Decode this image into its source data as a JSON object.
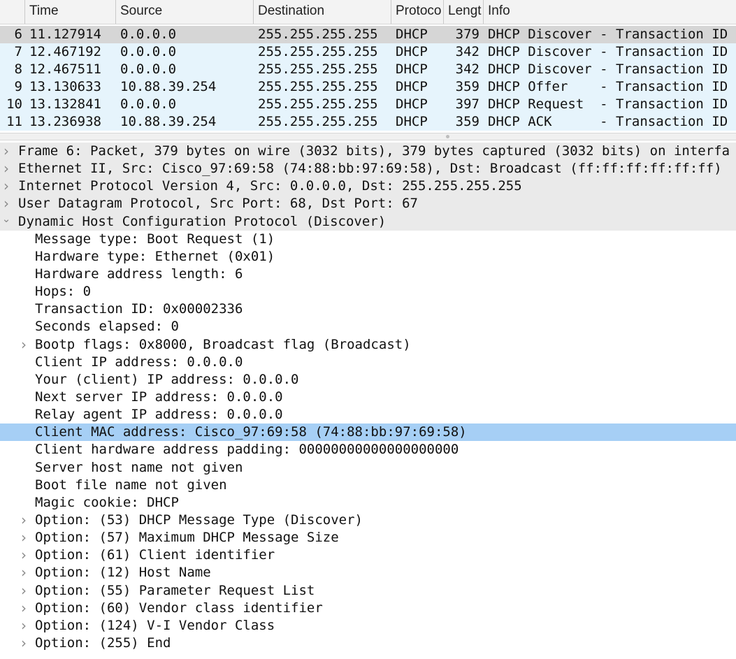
{
  "columns": [
    "Time",
    "Source",
    "Destination",
    "Protoco",
    "Lengt",
    "Info"
  ],
  "packets": [
    {
      "no": "6",
      "time": "11.127914",
      "source": "0.0.0.0",
      "destination": "255.255.255.255",
      "protocol": "DHCP",
      "length": "379",
      "info": "DHCP Discover - Transaction ID",
      "selected": true
    },
    {
      "no": "7",
      "time": "12.467192",
      "source": "0.0.0.0",
      "destination": "255.255.255.255",
      "protocol": "DHCP",
      "length": "342",
      "info": "DHCP Discover - Transaction ID",
      "selected": false
    },
    {
      "no": "8",
      "time": "12.467511",
      "source": "0.0.0.0",
      "destination": "255.255.255.255",
      "protocol": "DHCP",
      "length": "342",
      "info": "DHCP Discover - Transaction ID",
      "selected": false
    },
    {
      "no": "9",
      "time": "13.130633",
      "source": "10.88.39.254",
      "destination": "255.255.255.255",
      "protocol": "DHCP",
      "length": "359",
      "info": "DHCP Offer    - Transaction ID",
      "selected": false
    },
    {
      "no": "10",
      "time": "13.132841",
      "source": "0.0.0.0",
      "destination": "255.255.255.255",
      "protocol": "DHCP",
      "length": "397",
      "info": "DHCP Request  - Transaction ID",
      "selected": false
    },
    {
      "no": "11",
      "time": "13.236938",
      "source": "10.88.39.254",
      "destination": "255.255.255.255",
      "protocol": "DHCP",
      "length": "359",
      "info": "DHCP ACK      - Transaction ID",
      "selected": false
    }
  ],
  "details": [
    {
      "text": "Frame 6: Packet, 379 bytes on wire (3032 bits), 379 bytes captured (3032 bits) on interfa",
      "level": 0,
      "toggle": "collapsed",
      "style": "grey"
    },
    {
      "text": "Ethernet II, Src: Cisco_97:69:58 (74:88:bb:97:69:58), Dst: Broadcast (ff:ff:ff:ff:ff:ff)",
      "level": 0,
      "toggle": "collapsed",
      "style": "grey"
    },
    {
      "text": "Internet Protocol Version 4, Src: 0.0.0.0, Dst: 255.255.255.255",
      "level": 0,
      "toggle": "collapsed",
      "style": "grey"
    },
    {
      "text": "User Datagram Protocol, Src Port: 68, Dst Port: 67",
      "level": 0,
      "toggle": "collapsed",
      "style": "grey"
    },
    {
      "text": "Dynamic Host Configuration Protocol (Discover)",
      "level": 0,
      "toggle": "expanded",
      "style": "grey"
    },
    {
      "text": "Message type: Boot Request (1)",
      "level": 1,
      "toggle": "none",
      "style": ""
    },
    {
      "text": "Hardware type: Ethernet (0x01)",
      "level": 1,
      "toggle": "none",
      "style": ""
    },
    {
      "text": "Hardware address length: 6",
      "level": 1,
      "toggle": "none",
      "style": ""
    },
    {
      "text": "Hops: 0",
      "level": 1,
      "toggle": "none",
      "style": ""
    },
    {
      "text": "Transaction ID: 0x00002336",
      "level": 1,
      "toggle": "none",
      "style": ""
    },
    {
      "text": "Seconds elapsed: 0",
      "level": 1,
      "toggle": "none",
      "style": ""
    },
    {
      "text": "Bootp flags: 0x8000, Broadcast flag (Broadcast)",
      "level": 1,
      "toggle": "collapsed",
      "style": ""
    },
    {
      "text": "Client IP address: 0.0.0.0",
      "level": 1,
      "toggle": "none",
      "style": ""
    },
    {
      "text": "Your (client) IP address: 0.0.0.0",
      "level": 1,
      "toggle": "none",
      "style": ""
    },
    {
      "text": "Next server IP address: 0.0.0.0",
      "level": 1,
      "toggle": "none",
      "style": ""
    },
    {
      "text": "Relay agent IP address: 0.0.0.0",
      "level": 1,
      "toggle": "none",
      "style": ""
    },
    {
      "text": "Client MAC address: Cisco_97:69:58 (74:88:bb:97:69:58)",
      "level": 1,
      "toggle": "none",
      "style": "hl"
    },
    {
      "text": "Client hardware address padding: 00000000000000000000",
      "level": 1,
      "toggle": "none",
      "style": ""
    },
    {
      "text": "Server host name not given",
      "level": 1,
      "toggle": "none",
      "style": ""
    },
    {
      "text": "Boot file name not given",
      "level": 1,
      "toggle": "none",
      "style": ""
    },
    {
      "text": "Magic cookie: DHCP",
      "level": 1,
      "toggle": "none",
      "style": ""
    },
    {
      "text": "Option: (53) DHCP Message Type (Discover)",
      "level": 1,
      "toggle": "collapsed",
      "style": ""
    },
    {
      "text": "Option: (57) Maximum DHCP Message Size",
      "level": 1,
      "toggle": "collapsed",
      "style": ""
    },
    {
      "text": "Option: (61) Client identifier",
      "level": 1,
      "toggle": "collapsed",
      "style": ""
    },
    {
      "text": "Option: (12) Host Name",
      "level": 1,
      "toggle": "collapsed",
      "style": ""
    },
    {
      "text": "Option: (55) Parameter Request List",
      "level": 1,
      "toggle": "collapsed",
      "style": ""
    },
    {
      "text": "Option: (60) Vendor class identifier",
      "level": 1,
      "toggle": "collapsed",
      "style": ""
    },
    {
      "text": "Option: (124) V-I Vendor Class",
      "level": 1,
      "toggle": "collapsed",
      "style": ""
    },
    {
      "text": "Option: (255) End",
      "level": 1,
      "toggle": "collapsed",
      "style": ""
    }
  ],
  "icons": {
    "collapsed": "chevron-right-icon",
    "expanded": "chevron-down-icon"
  },
  "colors": {
    "row_background": "#e6f4fc",
    "row_selected": "#d6d6d6",
    "tree_header": "#eaeaea",
    "tree_highlight": "#a6cff5"
  }
}
